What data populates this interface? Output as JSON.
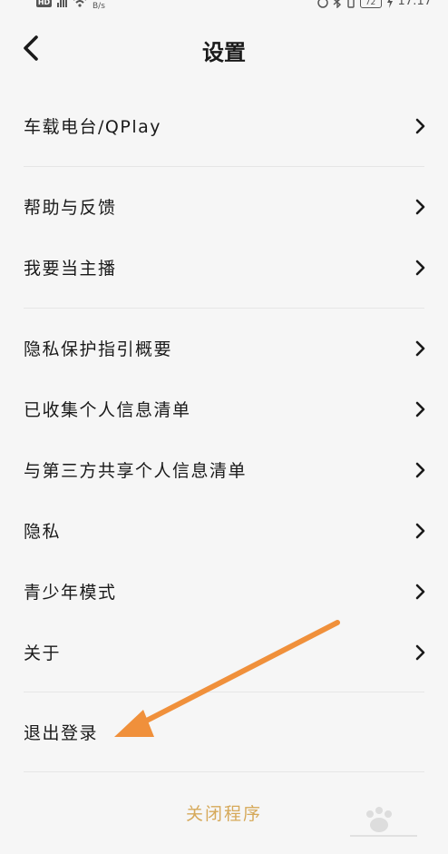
{
  "status_bar": {
    "network_badge": "HD",
    "speed": "B/s",
    "battery": "72",
    "time": "17:17"
  },
  "header": {
    "title": "设置"
  },
  "sections": [
    {
      "items": [
        {
          "label": "车载电台/QPlay"
        }
      ]
    },
    {
      "items": [
        {
          "label": "帮助与反馈"
        },
        {
          "label": "我要当主播"
        }
      ]
    },
    {
      "items": [
        {
          "label": "隐私保护指引概要"
        },
        {
          "label": "已收集个人信息清单"
        },
        {
          "label": "与第三方共享个人信息清单"
        },
        {
          "label": "隐私"
        },
        {
          "label": "青少年模式"
        },
        {
          "label": "关于"
        }
      ]
    }
  ],
  "logout": {
    "label": "退出登录"
  },
  "close_app": {
    "label": "关闭程序"
  },
  "annotation": {
    "arrow_color": "#f0903b"
  },
  "accent_color": "#d6a95a"
}
